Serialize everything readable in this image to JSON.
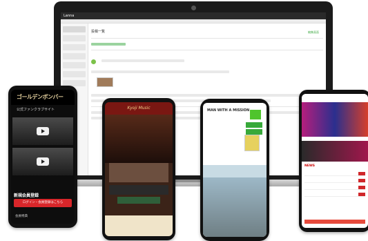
{
  "laptop": {
    "title": "Lanna",
    "page_heading": "投稿一覧",
    "green_link": "編集画面"
  },
  "phone1": {
    "logo_main": "ゴールデンボンバー",
    "logo_sub": "",
    "subtitle": "公式ファンクラブサイト",
    "member_label": "新規会員登録",
    "red_button": "ログイン・会員登録はこちら",
    "footer_link": "会員特典"
  },
  "phone2": {
    "band_title": "Kyoji Music"
  },
  "phone3": {
    "logo": "MAN WITH A MISSION",
    "menu_label": ""
  },
  "phone4": {
    "header": "",
    "news_title": "NEWS"
  },
  "colors": {
    "green": "#4caf50",
    "red": "#d8262a",
    "dark": "#111111"
  }
}
